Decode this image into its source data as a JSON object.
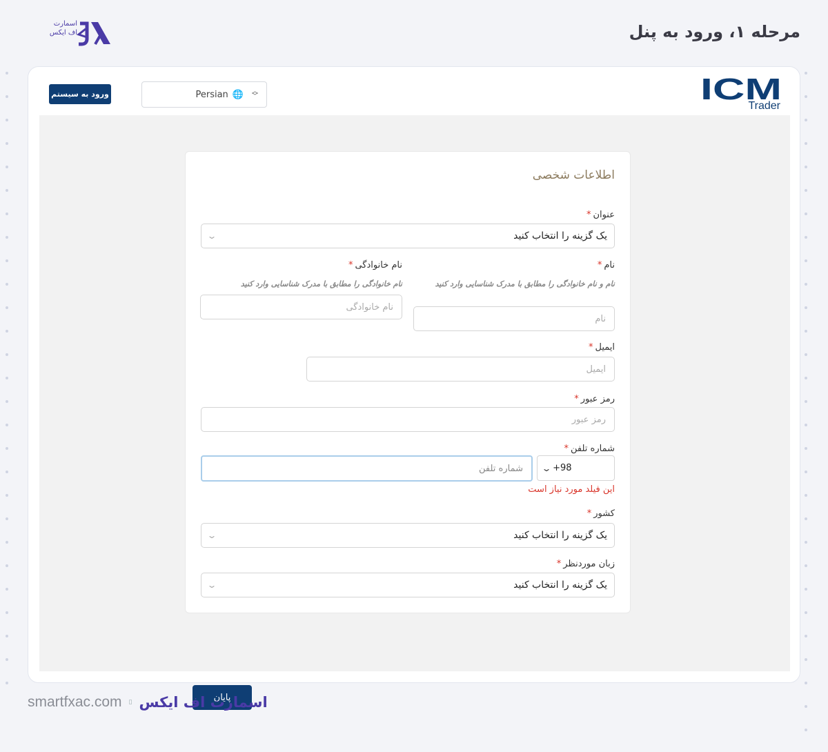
{
  "page_title": "مرحله ۱، ورود به پنل",
  "brand_logo_text": "اسمارت اف ایکس",
  "header": {
    "login_button": "ورود به سیستم",
    "language_value": "Persian",
    "logo_main": "ICM",
    "logo_sub": "Trader"
  },
  "form": {
    "section_title": "اطلاعات شخصی",
    "required_mark": "*",
    "title_label": "عنوان",
    "title_value": "یک گزینه را انتخاب کنید",
    "first_name_label": "نام",
    "first_name_hint": "نام و نام خانوادگی را مطابق با مدرک شناسایی وارد کنید",
    "first_name_placeholder": "نام",
    "last_name_label": "نام خانوادگی",
    "last_name_hint": "نام خانوادگی را مطابق با مدرک شناسایی وارد کنید",
    "last_name_placeholder": "نام خانوادگی",
    "email_label": "ایمیل",
    "email_placeholder": "ایمیل",
    "password_label": "رمز عبور",
    "password_placeholder": "رمز عبور",
    "phone_label": "شماره تلفن",
    "phone_placeholder": "شماره تلفن",
    "country_code": "+98",
    "phone_error": "این فیلد مورد نیاز است",
    "country_label": "کشور",
    "country_value": "یک گزینه را انتخاب کنید",
    "language_label": "زبان موردنظر",
    "language_value": "یک گزینه را انتخاب کنید",
    "finish_button": "پایان"
  },
  "footer": {
    "site": "smartfxac.com",
    "brand": "اسمارت اف ایکس"
  },
  "colors": {
    "primary": "#0f3e74",
    "brand_purple": "#4a3aa6",
    "error": "#d9352a",
    "title_gold": "#8c7b5e"
  }
}
